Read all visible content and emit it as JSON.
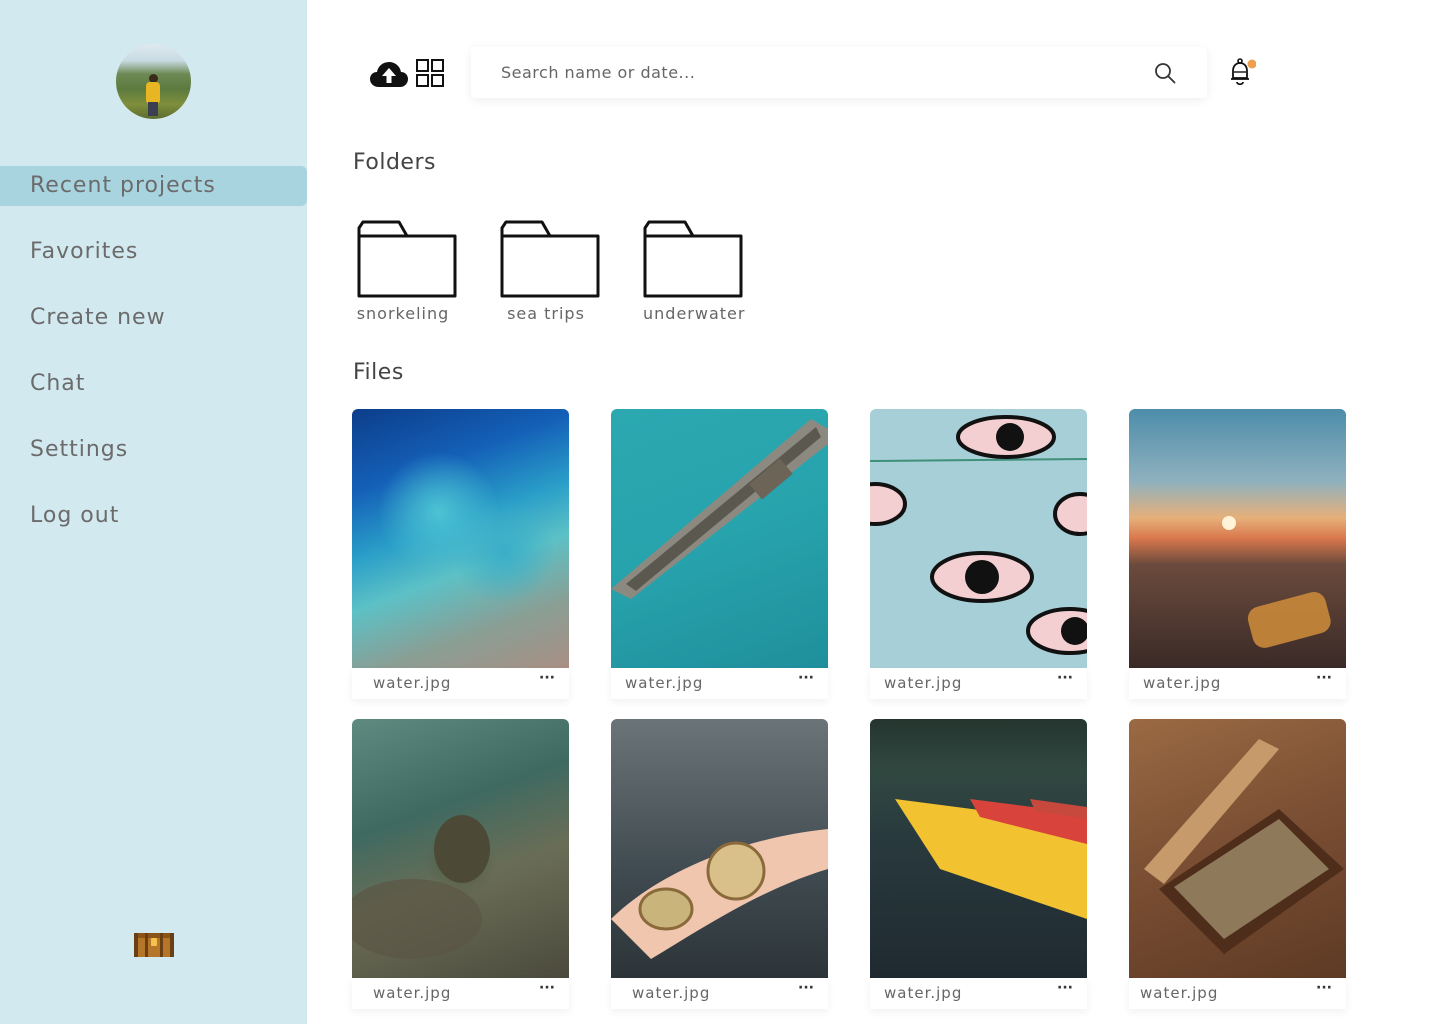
{
  "sidebar": {
    "avatar_alt": "",
    "items": [
      {
        "label": "Recent projects",
        "active": true
      },
      {
        "label": "Favorites",
        "active": false
      },
      {
        "label": "Create new",
        "active": false
      },
      {
        "label": "Chat",
        "active": false
      },
      {
        "label": "Settings",
        "active": false
      },
      {
        "label": "Log out",
        "active": false
      }
    ],
    "bottom_icon": "treasure-chest-icon"
  },
  "toolbar": {
    "upload_icon": "cloud-upload-icon",
    "view_icon": "grid-view-icon",
    "search_placeholder": "Search name or date...",
    "search_value": "",
    "search_icon": "search-icon",
    "notification_icon": "bell-icon",
    "notification_dot_color": "#f0a04b"
  },
  "folders": {
    "title": "Folders",
    "items": [
      {
        "label": "snorkeling"
      },
      {
        "label": "sea trips"
      },
      {
        "label": "underwater"
      }
    ]
  },
  "files": {
    "title": "Files",
    "items": [
      {
        "name": "water.jpg",
        "more": "···"
      },
      {
        "name": "water.jpg",
        "more": "···"
      },
      {
        "name": "water.jpg",
        "more": "···"
      },
      {
        "name": "water.jpg",
        "more": "···"
      },
      {
        "name": "water.jpg",
        "more": "···"
      },
      {
        "name": "water.jpg",
        "more": "···"
      },
      {
        "name": "water.jpg",
        "more": "···"
      },
      {
        "name": "water.jpg",
        "more": "···"
      }
    ]
  },
  "colors": {
    "sidebar_bg": "#d3e9f0",
    "active_item_bg": "#a8d4e0",
    "notification_dot": "#f0a04b"
  }
}
